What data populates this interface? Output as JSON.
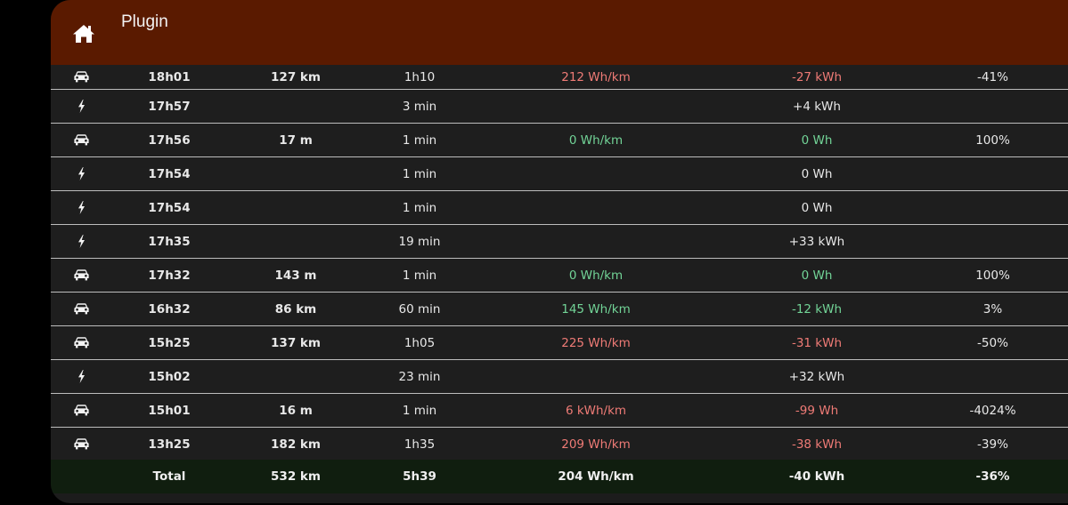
{
  "header": {
    "title": "Plugin",
    "home_icon": "home-icon"
  },
  "colors": {
    "header_bg": "#5a1a00",
    "negative": "#ef7b76",
    "positive": "#72d497",
    "total_bg": "#101e0f"
  },
  "rows": [
    {
      "type": "car",
      "time": "18h01",
      "distance": "127 km",
      "duration": "1h10",
      "efficiency": "212 Wh/km",
      "efficiency_tone": "red",
      "energy": "-27 kWh",
      "energy_tone": "red",
      "percent": "-41%"
    },
    {
      "type": "charge",
      "time": "17h57",
      "distance": "",
      "duration": "3 min",
      "efficiency": "",
      "efficiency_tone": "",
      "energy": "+4 kWh",
      "energy_tone": "",
      "percent": ""
    },
    {
      "type": "car",
      "time": "17h56",
      "distance": "17 m",
      "duration": "1 min",
      "efficiency": "0 Wh/km",
      "efficiency_tone": "green",
      "energy": "0 Wh",
      "energy_tone": "green",
      "percent": "100%"
    },
    {
      "type": "charge",
      "time": "17h54",
      "distance": "",
      "duration": "1 min",
      "efficiency": "",
      "efficiency_tone": "",
      "energy": "0 Wh",
      "energy_tone": "",
      "percent": ""
    },
    {
      "type": "charge",
      "time": "17h54",
      "distance": "",
      "duration": "1 min",
      "efficiency": "",
      "efficiency_tone": "",
      "energy": "0 Wh",
      "energy_tone": "",
      "percent": ""
    },
    {
      "type": "charge",
      "time": "17h35",
      "distance": "",
      "duration": "19 min",
      "efficiency": "",
      "efficiency_tone": "",
      "energy": "+33 kWh",
      "energy_tone": "",
      "percent": ""
    },
    {
      "type": "car",
      "time": "17h32",
      "distance": "143 m",
      "duration": "1 min",
      "efficiency": "0 Wh/km",
      "efficiency_tone": "green",
      "energy": "0 Wh",
      "energy_tone": "green",
      "percent": "100%"
    },
    {
      "type": "car",
      "time": "16h32",
      "distance": "86 km",
      "duration": "60 min",
      "efficiency": "145 Wh/km",
      "efficiency_tone": "green",
      "energy": "-12 kWh",
      "energy_tone": "green",
      "percent": "3%"
    },
    {
      "type": "car",
      "time": "15h25",
      "distance": "137 km",
      "duration": "1h05",
      "efficiency": "225 Wh/km",
      "efficiency_tone": "red",
      "energy": "-31 kWh",
      "energy_tone": "red",
      "percent": "-50%"
    },
    {
      "type": "charge",
      "time": "15h02",
      "distance": "",
      "duration": "23 min",
      "efficiency": "",
      "efficiency_tone": "",
      "energy": "+32 kWh",
      "energy_tone": "",
      "percent": ""
    },
    {
      "type": "car",
      "time": "15h01",
      "distance": "16 m",
      "duration": "1 min",
      "efficiency": "6 kWh/km",
      "efficiency_tone": "red",
      "energy": "-99 Wh",
      "energy_tone": "red",
      "percent": "-4024%"
    },
    {
      "type": "car",
      "time": "13h25",
      "distance": "182 km",
      "duration": "1h35",
      "efficiency": "209 Wh/km",
      "efficiency_tone": "red",
      "energy": "-38 kWh",
      "energy_tone": "red",
      "percent": "-39%"
    }
  ],
  "total": {
    "label": "Total",
    "distance": "532 km",
    "duration": "5h39",
    "efficiency": "204 Wh/km",
    "energy": "-40 kWh",
    "percent": "-36%"
  }
}
